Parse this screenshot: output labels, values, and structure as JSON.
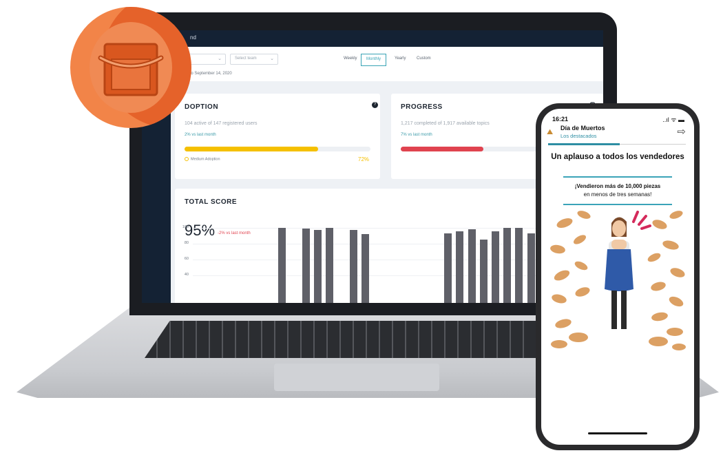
{
  "dashboard": {
    "topbar_title": "nd",
    "filters": {
      "first_dropdown": "",
      "second_dropdown": "Select team",
      "periods": [
        "Weekly",
        "Monthly",
        "Yearly",
        "Custom"
      ],
      "active_period": "Monthly",
      "date_range": "4, 2020 to September 14, 2020"
    },
    "adoption": {
      "title": "DOPTION",
      "subtitle": "104 active of 147 registered users",
      "trend": "2% vs last month",
      "progress": 0.72,
      "bar_color": "#f5c000",
      "legend": "Medium Adoption",
      "percent_label": "72%"
    },
    "progress_card": {
      "title": "PROGRESS",
      "subtitle": "1,217 completed of 1,917 available topics",
      "trend": "7% vs last month",
      "progress": 0.6,
      "bar_color": "#e0434f"
    },
    "total_score": {
      "title": "TOTAL SCORE",
      "value": "95%",
      "trend": "-2% vs last month"
    },
    "chart_data": {
      "type": "bar",
      "title": "",
      "xlabel": "",
      "ylabel": "",
      "ylim": [
        0,
        100
      ],
      "yticks": [
        "100",
        "80",
        "60",
        "40"
      ],
      "bar_color": "#5f6068",
      "values": [
        0,
        0,
        0,
        0,
        0,
        0,
        0,
        100,
        0,
        99,
        97,
        100,
        0,
        97,
        92,
        0,
        0,
        0,
        0,
        0,
        0,
        93,
        96,
        98,
        85,
        96,
        100,
        100,
        93,
        95,
        95,
        95
      ]
    }
  },
  "phone": {
    "time": "16:21",
    "status_icons": "..ıl ᯤ ▬",
    "app_title": "Día de Muertos",
    "app_subtitle": "Los destacados",
    "headline": "Un aplauso a todos los vendedores",
    "message_line1": "¡Vendieron más de 10,000 piezas",
    "message_line2": "en menos de tres semanas!"
  },
  "colors": {
    "accent_teal": "#37a3b5",
    "logo_orange": "#f28448"
  }
}
